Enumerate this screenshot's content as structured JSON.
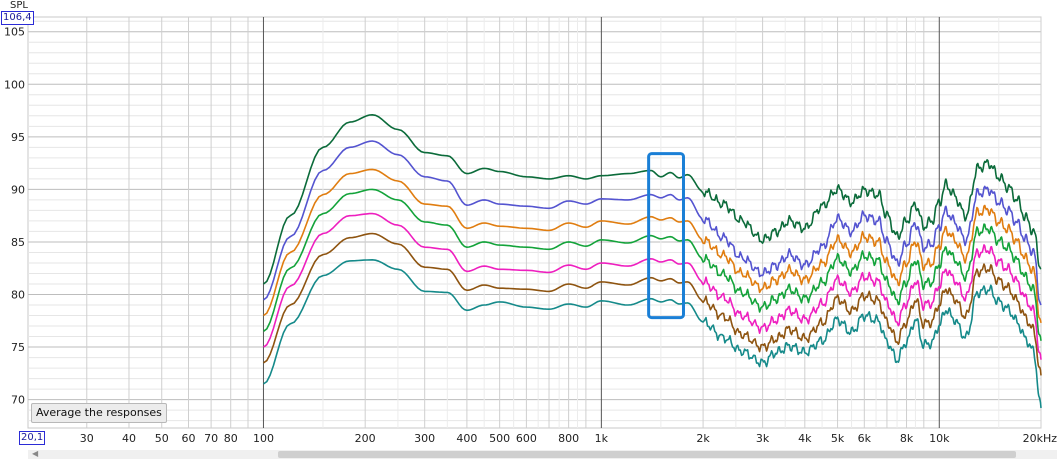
{
  "window": {
    "y_axis_unit": "SPL",
    "y_top_value": "106,4",
    "x_left_value": "20,1",
    "button_label": "Average the responses"
  },
  "chart_data": {
    "type": "line",
    "title": "",
    "xlabel": "",
    "ylabel": "SPL",
    "x_scale": "log",
    "xlim": [
      20.1,
      20000
    ],
    "ylim": [
      67.3,
      106.4
    ],
    "grid": true,
    "y_ticks": [
      70,
      75,
      80,
      85,
      90,
      95,
      100,
      105
    ],
    "y_tick_labels": [
      "70",
      "75",
      "80",
      "85",
      "90",
      "95",
      "100",
      "105"
    ],
    "x_ticks": [
      30,
      40,
      50,
      60,
      70,
      80,
      100,
      200,
      300,
      400,
      500,
      600,
      800,
      1000,
      2000,
      3000,
      4000,
      5000,
      6000,
      8000,
      10000,
      20000
    ],
    "x_tick_labels": [
      "30",
      "40",
      "50",
      "60",
      "70",
      "80",
      "100",
      "200",
      "300",
      "400",
      "500",
      "600",
      "800",
      "1k",
      "2k",
      "3k",
      "4k",
      "5k",
      "6k",
      "8k",
      "10k",
      "20kHz"
    ],
    "x": [
      100,
      120,
      150,
      180,
      210,
      250,
      300,
      350,
      400,
      450,
      500,
      600,
      700,
      800,
      900,
      1000,
      1200,
      1400,
      1500,
      1600,
      1700,
      1800,
      2000,
      2300,
      2600,
      3000,
      3300,
      3600,
      4000,
      4500,
      5000,
      5500,
      6000,
      6600,
      7000,
      7500,
      8000,
      8500,
      9000,
      9500,
      10000,
      10500,
      11000,
      12000,
      13000,
      14000,
      15000,
      16000,
      17000,
      18000,
      19000,
      20000
    ],
    "series": [
      {
        "color": "#0b6b3a",
        "values": [
          81.0,
          87.5,
          94.0,
          96.4,
          97.1,
          95.7,
          93.5,
          93.2,
          91.5,
          92.0,
          91.7,
          91.2,
          91.0,
          91.3,
          91.0,
          91.3,
          91.5,
          91.8,
          91.2,
          91.6,
          91.1,
          91.4,
          89.8,
          88.6,
          87.0,
          85.2,
          86.0,
          87.0,
          86.3,
          88.4,
          90.0,
          88.8,
          89.9,
          89.5,
          87.5,
          85.5,
          87.0,
          88.6,
          86.5,
          87.0,
          88.8,
          90.5,
          89.5,
          87.5,
          92.0,
          92.5,
          91.2,
          90.2,
          89.0,
          87.3,
          86.0,
          82.5
        ]
      },
      {
        "color": "#5454d0",
        "values": [
          79.5,
          85.5,
          91.8,
          94.0,
          94.6,
          93.3,
          91.2,
          90.8,
          88.5,
          89.0,
          88.6,
          88.4,
          88.2,
          88.9,
          88.6,
          89.1,
          89.0,
          89.5,
          89.2,
          89.5,
          89.0,
          89.2,
          87.2,
          85.4,
          83.5,
          82.0,
          82.8,
          83.8,
          82.8,
          84.5,
          87.2,
          86.0,
          87.5,
          87.0,
          85.0,
          83.0,
          84.8,
          86.8,
          84.5,
          84.8,
          86.5,
          88.0,
          87.0,
          85.2,
          89.6,
          90.0,
          88.8,
          88.0,
          86.8,
          85.2,
          84.0,
          79.0
        ]
      },
      {
        "color": "#e07d10",
        "values": [
          78.0,
          84.0,
          89.5,
          91.5,
          91.9,
          90.8,
          88.6,
          88.4,
          86.3,
          86.8,
          86.5,
          86.3,
          86.1,
          86.8,
          86.4,
          87.0,
          86.7,
          87.4,
          87.1,
          87.3,
          86.9,
          87.0,
          85.2,
          83.7,
          82.0,
          80.6,
          81.4,
          82.3,
          81.4,
          82.9,
          85.2,
          84.0,
          85.5,
          85.0,
          83.0,
          81.2,
          83.0,
          85.1,
          82.8,
          83.0,
          84.7,
          86.2,
          85.3,
          83.5,
          87.8,
          88.1,
          86.9,
          86.2,
          85.0,
          83.4,
          82.2,
          77.3
        ]
      },
      {
        "color": "#13a33a",
        "values": [
          76.5,
          82.5,
          87.7,
          89.6,
          90.0,
          89.0,
          86.9,
          86.6,
          84.5,
          85.0,
          84.7,
          84.5,
          84.3,
          85.0,
          84.6,
          85.2,
          84.9,
          85.6,
          85.3,
          85.5,
          85.1,
          85.2,
          83.4,
          81.9,
          80.2,
          78.8,
          79.6,
          80.5,
          79.6,
          81.1,
          83.4,
          82.2,
          83.7,
          83.2,
          81.2,
          79.4,
          81.2,
          83.3,
          81.0,
          81.2,
          82.9,
          84.4,
          83.5,
          81.7,
          86.0,
          86.3,
          85.1,
          84.4,
          83.2,
          81.6,
          80.4,
          75.6
        ]
      },
      {
        "color": "#ee1fbf",
        "values": [
          75.0,
          80.8,
          85.8,
          87.5,
          87.7,
          86.6,
          84.5,
          84.3,
          82.2,
          82.7,
          82.4,
          82.3,
          82.1,
          82.8,
          82.4,
          83.0,
          82.7,
          83.4,
          83.1,
          83.3,
          82.9,
          83.0,
          81.2,
          79.7,
          78.0,
          76.8,
          77.6,
          78.5,
          77.6,
          79.1,
          81.4,
          80.2,
          81.7,
          81.2,
          79.2,
          77.4,
          79.2,
          81.3,
          79.0,
          79.2,
          80.9,
          82.4,
          81.5,
          79.7,
          84.0,
          84.3,
          83.1,
          82.4,
          81.2,
          79.6,
          78.4,
          73.8
        ]
      },
      {
        "color": "#8e5410",
        "values": [
          73.5,
          79.0,
          83.8,
          85.4,
          85.8,
          84.8,
          82.6,
          82.4,
          80.4,
          80.9,
          80.6,
          80.5,
          80.3,
          81.0,
          80.6,
          81.2,
          80.9,
          81.6,
          81.3,
          81.5,
          81.1,
          81.2,
          79.4,
          77.9,
          76.2,
          75.0,
          75.8,
          76.7,
          75.8,
          77.3,
          79.6,
          78.4,
          79.9,
          79.4,
          77.4,
          75.6,
          77.4,
          79.5,
          77.2,
          77.4,
          79.1,
          80.6,
          79.7,
          77.9,
          82.2,
          82.5,
          81.3,
          80.6,
          79.4,
          77.8,
          76.6,
          72.3
        ]
      },
      {
        "color": "#158a8a",
        "values": [
          71.5,
          77.2,
          81.8,
          83.2,
          83.3,
          82.4,
          80.3,
          80.2,
          78.5,
          79.0,
          79.3,
          78.8,
          78.6,
          79.1,
          78.8,
          79.4,
          79.0,
          79.6,
          79.3,
          79.5,
          79.1,
          79.2,
          77.4,
          75.9,
          74.6,
          73.5,
          74.5,
          75.1,
          74.5,
          75.6,
          77.6,
          76.4,
          78.0,
          77.5,
          75.5,
          73.8,
          75.5,
          77.6,
          75.2,
          75.4,
          77.1,
          78.6,
          77.7,
          75.9,
          80.2,
          80.5,
          79.3,
          78.6,
          77.4,
          75.8,
          74.6,
          69.2
        ]
      }
    ],
    "highlight_box": {
      "x_range": [
        1380,
        1750
      ],
      "y_range": [
        77.8,
        93.4
      ],
      "color": "#1a7fd6"
    }
  }
}
